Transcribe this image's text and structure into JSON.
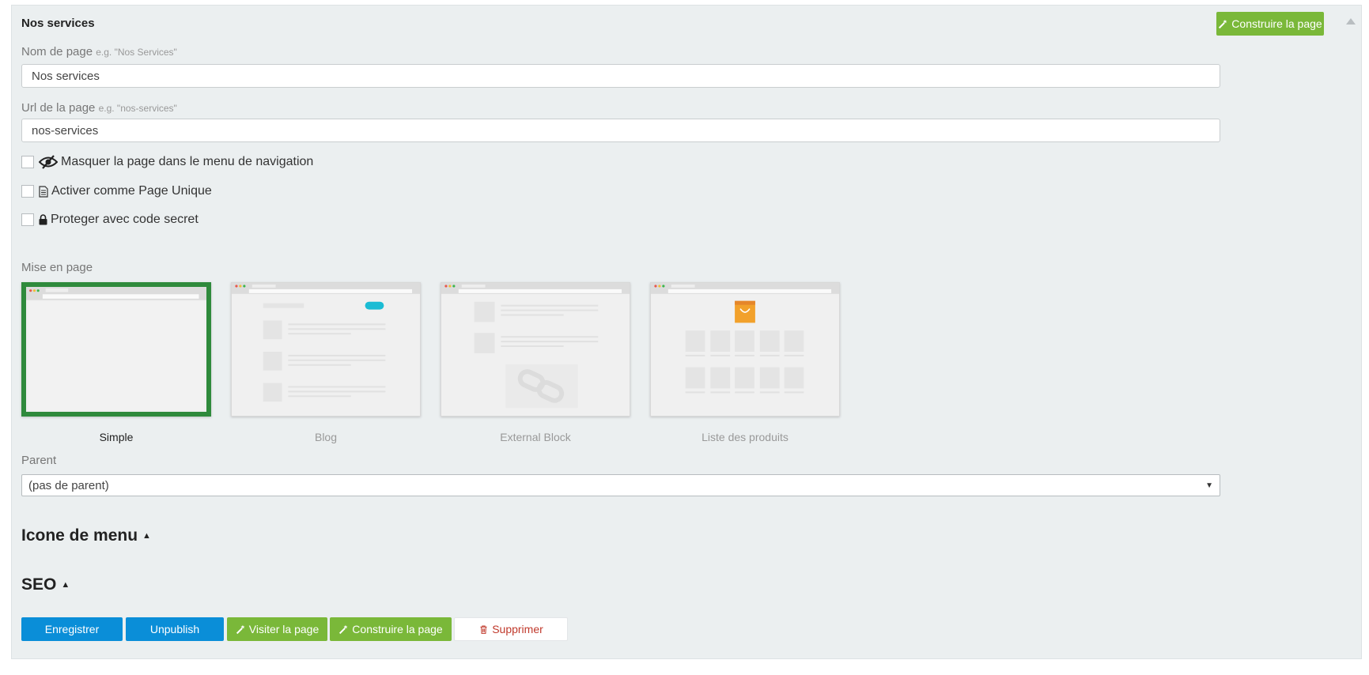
{
  "panel": {
    "title": "Nos services",
    "build_button": "Construire la page"
  },
  "fields": {
    "page_name": {
      "label": "Nom de page",
      "hint": "e.g. \"Nos Services\"",
      "value": "Nos services"
    },
    "page_url": {
      "label": "Url de la page",
      "hint": "e.g. \"nos-services\"",
      "value": "nos-services"
    }
  },
  "options": [
    {
      "label": "Masquer la page dans le menu de navigation",
      "icon": "eye-slash-icon",
      "checked": false
    },
    {
      "label": "Activer comme Page Unique",
      "icon": "file-text-icon",
      "checked": false
    },
    {
      "label": "Proteger avec code secret",
      "icon": "lock-icon",
      "checked": false
    }
  ],
  "layout": {
    "label": "Mise en page",
    "choices": [
      {
        "name": "Simple",
        "selected": true
      },
      {
        "name": "Blog",
        "selected": false
      },
      {
        "name": "External Block",
        "selected": false
      },
      {
        "name": "Liste des produits",
        "selected": false
      }
    ]
  },
  "parent": {
    "label": "Parent",
    "value": "(pas de parent)"
  },
  "sections": {
    "menu_icon": "Icone de menu",
    "seo": "SEO"
  },
  "actions": {
    "save": "Enregistrer",
    "unpublish": "Unpublish",
    "visit": "Visiter la page",
    "build": "Construire la page",
    "delete": "Supprimer"
  },
  "colors": {
    "green": "#7ab839",
    "blue": "#0a8ed8",
    "selected_border": "#2f8a3c",
    "delete_text": "#c0392b"
  }
}
